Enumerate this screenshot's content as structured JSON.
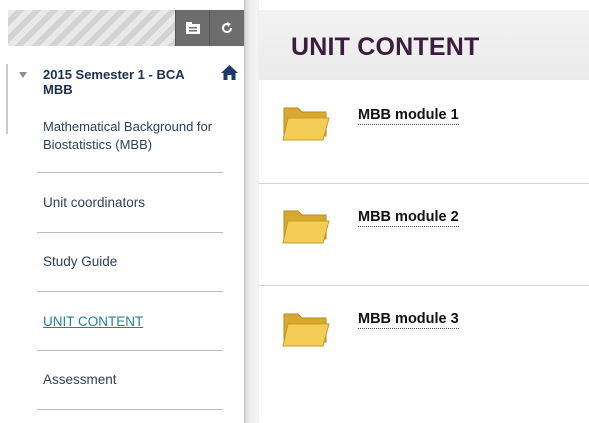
{
  "sidebar": {
    "course_title": "2015 Semester 1 - BCA MBB",
    "course_subtitle": "Mathematical Background for Biostatistics (MBB)",
    "items": [
      {
        "label": "Unit coordinators",
        "active": false
      },
      {
        "label": "Study Guide",
        "active": false
      },
      {
        "label": "UNIT CONTENT",
        "active": true
      },
      {
        "label": "Assessment",
        "active": false
      }
    ]
  },
  "header_icons": [
    "folder-view-icon",
    "refresh-icon",
    "home-icon",
    "collapse-triangle-icon"
  ],
  "content": {
    "title": "UNIT CONTENT",
    "modules": [
      {
        "label": "MBB module 1",
        "icon": "folder-icon"
      },
      {
        "label": "MBB module 2",
        "icon": "folder-icon"
      },
      {
        "label": "MBB module 3",
        "icon": "folder-icon"
      }
    ]
  },
  "colors": {
    "title_color": "#3b1d3d",
    "nav_text": "#2c3f5c",
    "active_link": "#2a7ea0",
    "folder_yellow": "#f2c84a"
  }
}
